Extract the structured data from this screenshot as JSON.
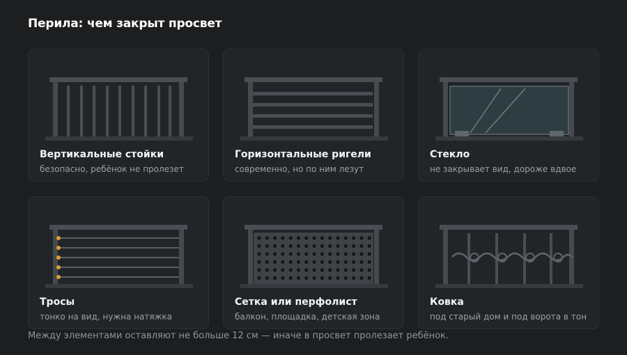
{
  "title": "Перила: чем закрыт просвет",
  "cards": [
    {
      "title": "Вертикальные стойки",
      "subtitle": "безопасно, ребёнок не пролезет",
      "icon": "vertical-balusters-icon"
    },
    {
      "title": "Горизонтальные ригели",
      "subtitle": "современно, но по ним лезут",
      "icon": "horizontal-rails-icon"
    },
    {
      "title": "Стекло",
      "subtitle": "не закрывает вид, дороже вдвое",
      "icon": "glass-panel-icon"
    },
    {
      "title": "Тросы",
      "subtitle": "тонко на вид, нужна натяжка",
      "icon": "cable-railing-icon"
    },
    {
      "title": "Сетка или перфолист",
      "subtitle": "балкон, площадка, детская зона",
      "icon": "perforated-sheet-icon"
    },
    {
      "title": "Ковка",
      "subtitle": "под старый дом и под ворота в тон",
      "icon": "wrought-iron-icon"
    }
  ],
  "footnote": "Между элементами оставляют не больше 12 см — иначе в просвет пролезает ребёнок.",
  "colors": {
    "background": "#1c1e20",
    "card": "#222528",
    "metal": "#4a4e54",
    "accent": "#e0a030"
  }
}
